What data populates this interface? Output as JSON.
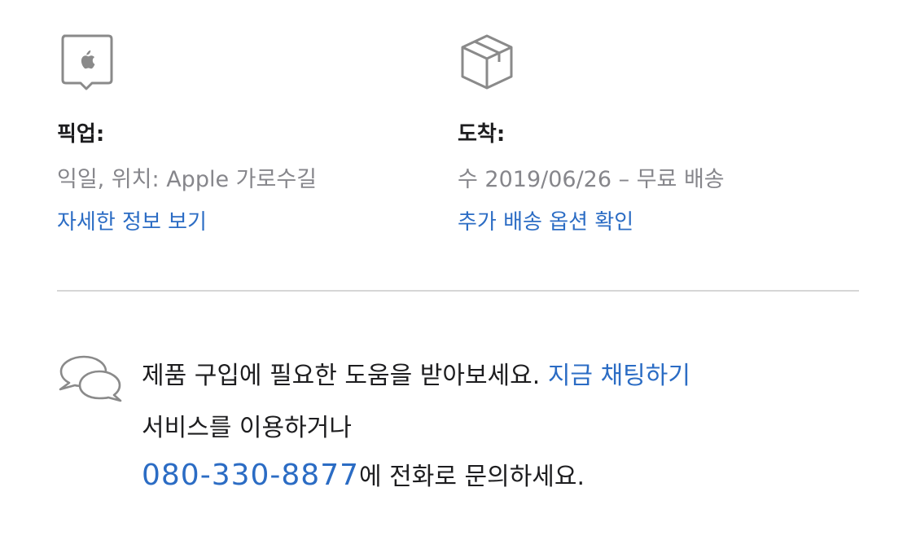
{
  "pickup": {
    "icon": "apple-store-pin-icon",
    "heading": "픽업:",
    "detail": "익일, 위치: Apple 가로수길",
    "link": "자세한 정보 보기"
  },
  "delivery": {
    "icon": "package-box-icon",
    "heading": "도착:",
    "detail": "수 2019/06/26 – 무료 배송",
    "link": "추가 배송 옵션 확인"
  },
  "help": {
    "icon": "chat-bubbles-icon",
    "line1_text": "제품 구입에 필요한 도움을 받아보세요.",
    "chat_link": "지금 채팅하기",
    "line2_text": "서비스를 이용하거나",
    "phone": "080-330-8877",
    "line3_suffix": "에 전화로 문의하세요."
  },
  "colors": {
    "link": "#2b6cc4",
    "text": "#1d1d1f",
    "muted": "#86868b",
    "divider": "#d6d6d6"
  }
}
